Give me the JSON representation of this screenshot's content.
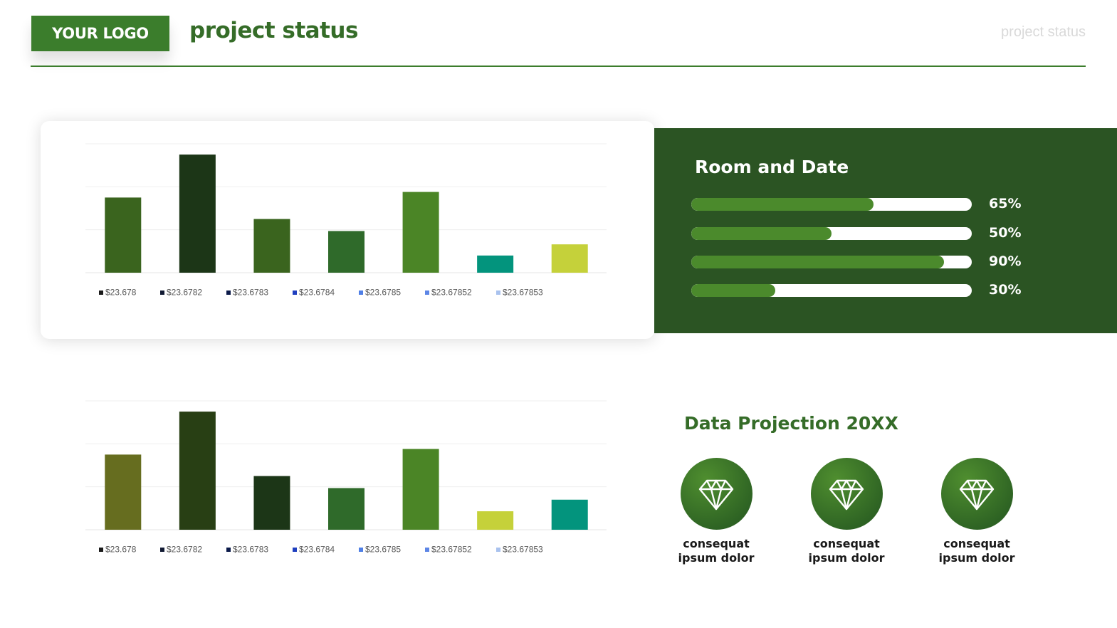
{
  "header": {
    "logo": "YOUR LOGO",
    "title": "project status",
    "top_right": "project status"
  },
  "colors": {
    "accent": "#3b7d2c",
    "panel": "#2b5423",
    "title_green": "#356c28"
  },
  "chart_data": [
    {
      "type": "bar",
      "categories": [
        "$23.678",
        "$23.6782",
        "$23.6783",
        "$23.6784",
        "$23.6785",
        "$23.67852",
        "$23.67853"
      ],
      "values": [
        1.75,
        2.75,
        1.25,
        0.97,
        1.88,
        0.4,
        0.66
      ],
      "bar_colors": [
        "#3a641e",
        "#1c3617",
        "#3a641e",
        "#2f6a2a",
        "#4b8526",
        "#03947d",
        "#c5d13a"
      ],
      "legend_colors": [
        "#1a1a1a",
        "#111a33",
        "#0b1a4a",
        "#1f3fbf",
        "#4f7fe6",
        "#5d86e6",
        "#a9c2ee"
      ],
      "ylim": [
        0,
        3
      ],
      "grid": true,
      "legend_position": "bottom"
    },
    {
      "type": "bar",
      "categories": [
        "$23.678",
        "$23.6782",
        "$23.6783",
        "$23.6784",
        "$23.6785",
        "$23.67852",
        "$23.67853"
      ],
      "values": [
        1.75,
        2.75,
        1.25,
        0.97,
        1.88,
        0.43,
        0.7
      ],
      "bar_colors": [
        "#666d1f",
        "#283f14",
        "#1c3617",
        "#2f6a2a",
        "#4b8526",
        "#c5d13a",
        "#03947d"
      ],
      "legend_colors": [
        "#1a1a1a",
        "#111a33",
        "#0b1a4a",
        "#1f3fbf",
        "#4f7fe6",
        "#5d86e6",
        "#a9c2ee"
      ],
      "ylim": [
        0,
        3
      ],
      "grid": true,
      "legend_position": "bottom"
    }
  ],
  "room_and_date": {
    "title": "Room and Date",
    "items": [
      {
        "value": 0.65,
        "label": "65%"
      },
      {
        "value": 0.5,
        "label": "50%"
      },
      {
        "value": 0.9,
        "label": "90%"
      },
      {
        "value": 0.3,
        "label": "30%"
      }
    ]
  },
  "projection": {
    "title": "Data Projection 20XX",
    "features": [
      {
        "icon": "diamond-icon",
        "line1": "consequat",
        "line2": "ipsum dolor"
      },
      {
        "icon": "diamond-icon",
        "line1": "consequat",
        "line2": "ipsum dolor"
      },
      {
        "icon": "diamond-icon",
        "line1": "consequat",
        "line2": "ipsum dolor"
      }
    ]
  }
}
